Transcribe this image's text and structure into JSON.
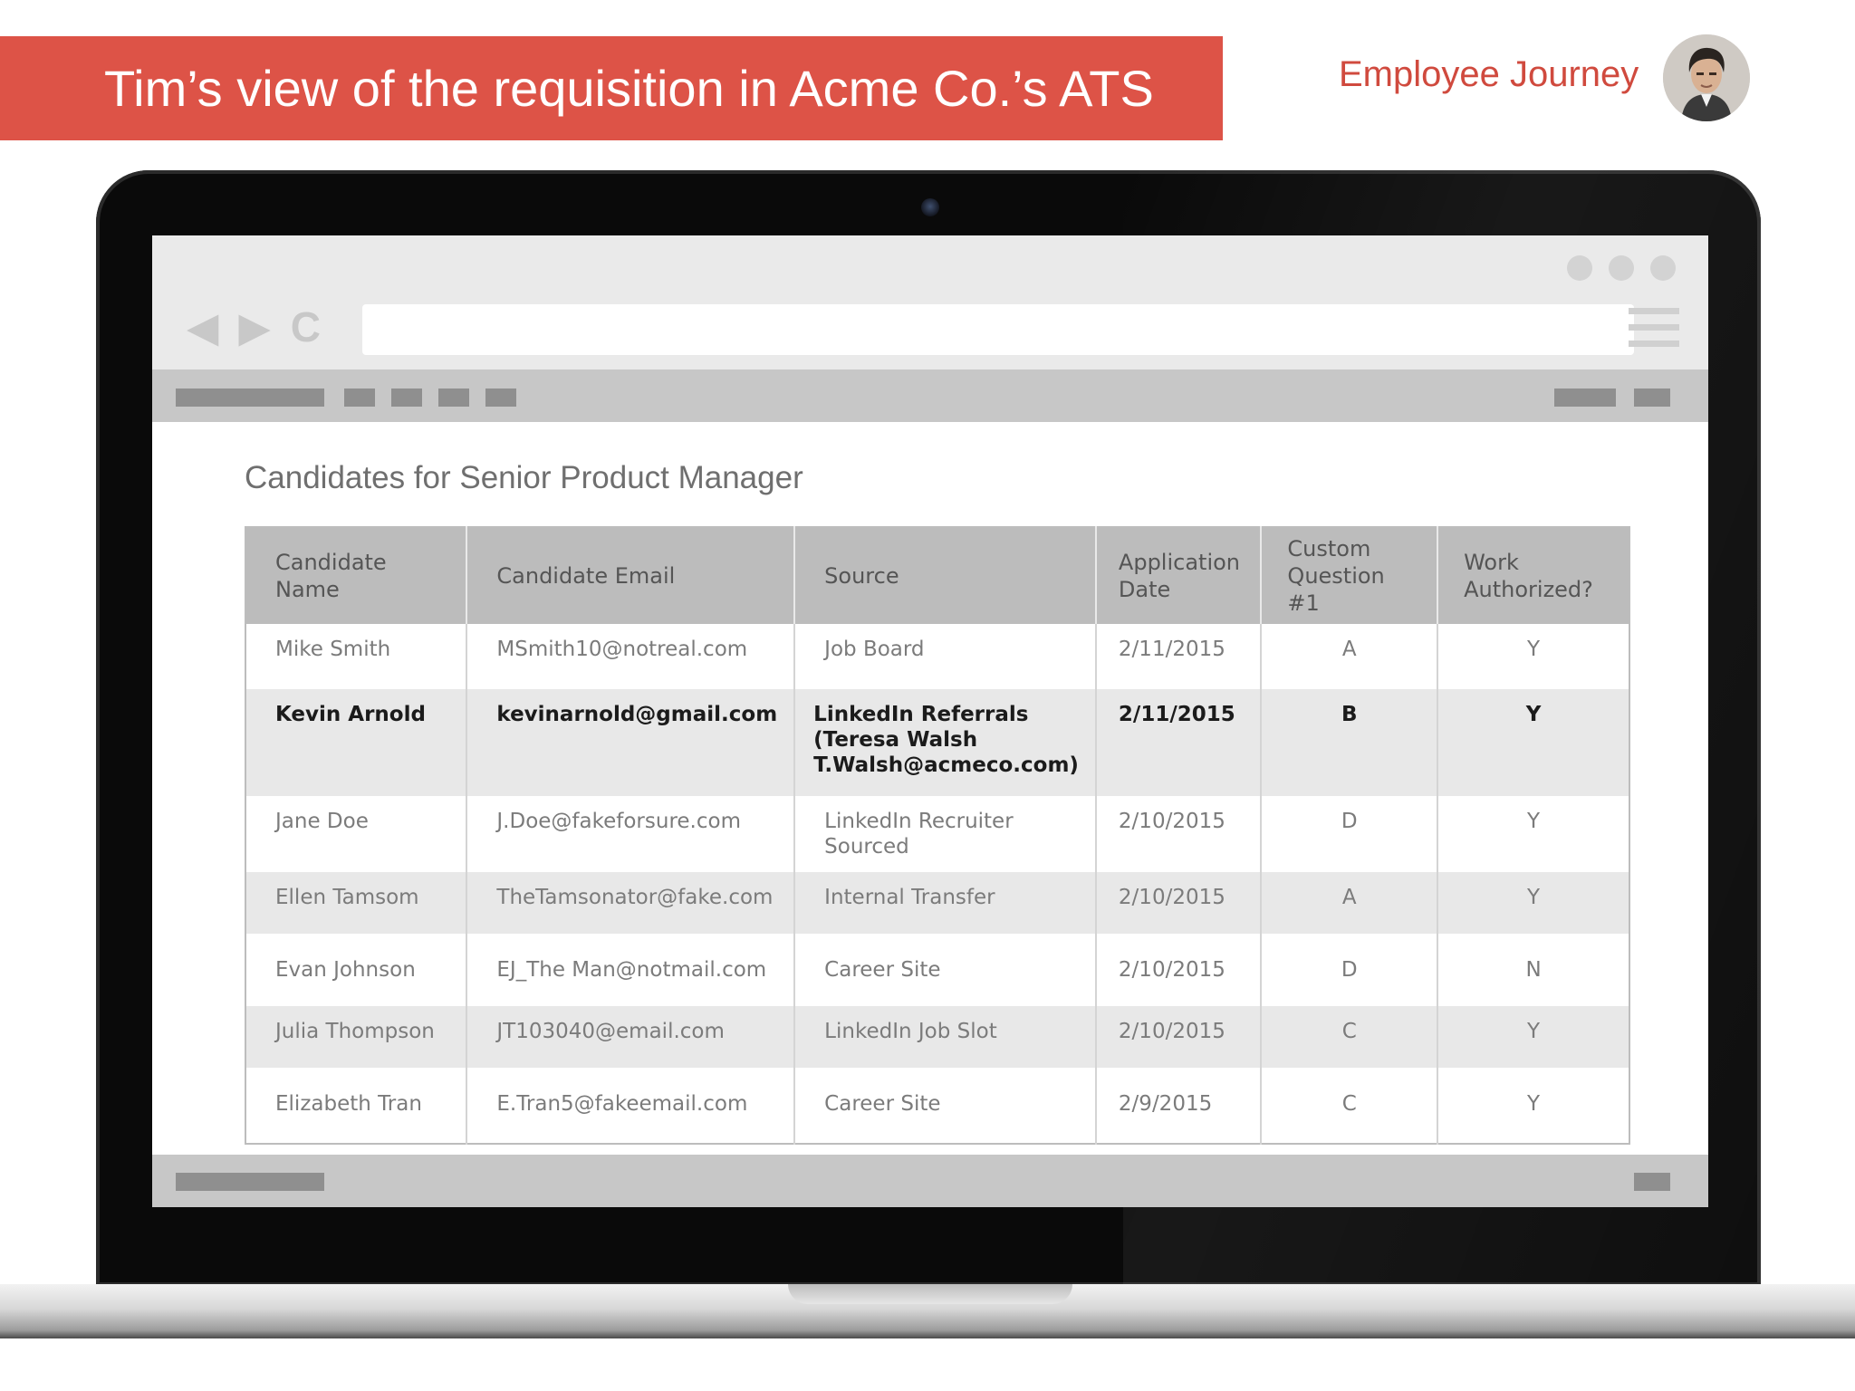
{
  "banner": {
    "title": "Tim’s view of the requisition in Acme Co.’s ATS",
    "background": "#dd5347"
  },
  "header": {
    "section_label": "Employee Journey",
    "avatar_icon": "person-photo"
  },
  "browser": {
    "back_icon": "◀",
    "forward_icon": "▶",
    "reload_icon": "C",
    "url": "",
    "menu_icon": "hamburger-icon"
  },
  "page": {
    "heading": "Candidates for Senior Product Manager"
  },
  "table": {
    "columns": [
      "Candidate Name",
      "Candidate Email",
      "Source",
      "Application Date",
      "Custom Question #1",
      "Work Authorized?"
    ],
    "rows": [
      {
        "name": "Mike Smith",
        "email": "MSmith10@notreal.com",
        "source": "Job Board",
        "date": "2/11/2015",
        "q1": "A",
        "auth": "Y"
      },
      {
        "name": "Kevin Arnold",
        "email": "kevinarnold@gmail.com",
        "source": "LinkedIn Referrals (Teresa Walsh T.Walsh@acmeco.com)",
        "date": "2/11/2015",
        "q1": "B",
        "auth": "Y",
        "highlighted": true
      },
      {
        "name": "Jane Doe",
        "email": "J.Doe@fakeforsure.com",
        "source": "LinkedIn Recruiter Sourced",
        "date": "2/10/2015",
        "q1": "D",
        "auth": "Y"
      },
      {
        "name": "Ellen Tamsom",
        "email": "TheTamsonator@fake.com",
        "source": "Internal Transfer",
        "date": "2/10/2015",
        "q1": "A",
        "auth": "Y"
      },
      {
        "name": "Evan Johnson",
        "email": "EJ_The Man@notmail.com",
        "source": "Career Site",
        "date": "2/10/2015",
        "q1": "D",
        "auth": "N"
      },
      {
        "name": "Julia Thompson",
        "email": "JT103040@email.com",
        "source": "LinkedIn Job Slot",
        "date": "2/10/2015",
        "q1": "C",
        "auth": "Y"
      },
      {
        "name": "Elizabeth Tran",
        "email": "E.Tran5@fakeemail.com",
        "source": "Career Site",
        "date": "2/9/2015",
        "q1": "C",
        "auth": "Y"
      }
    ]
  }
}
